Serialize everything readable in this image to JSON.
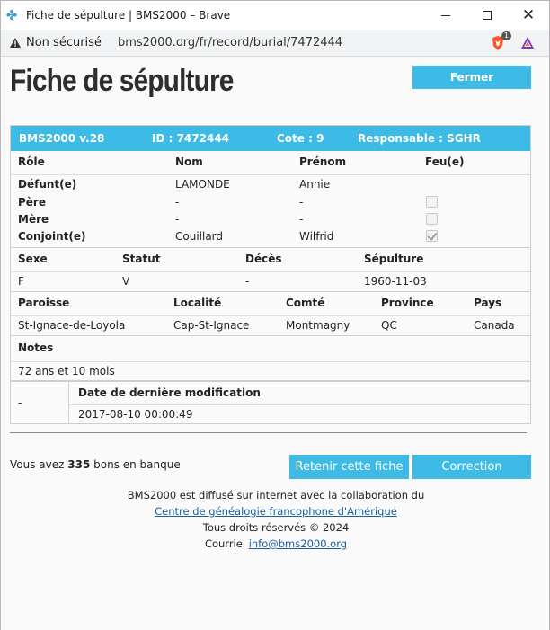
{
  "window": {
    "title": "Fiche de sépulture | BMS2000 – Brave",
    "minimize": "—",
    "maximize": "☐",
    "close": "✕"
  },
  "address_bar": {
    "security_label": "Non sécurisé",
    "url": "bms2000.org/fr/record/burial/7472444",
    "brave_badge": "1"
  },
  "page": {
    "title": "Fiche de sépulture",
    "close_button": "Fermer"
  },
  "record": {
    "header": {
      "version": "BMS2000 v.28",
      "id": "ID : 7472444",
      "cote": "Cote : 9",
      "responsable": "Responsable : SGHR"
    },
    "persons_headers": {
      "role": "Rôle",
      "nom": "Nom",
      "prenom": "Prénom",
      "feu": "Feu(e)"
    },
    "persons": [
      {
        "role": "Défunt(e)",
        "nom": "LAMONDE",
        "prenom": "Annie",
        "feu": null
      },
      {
        "role": "Père",
        "nom": "-",
        "prenom": "-",
        "feu": false
      },
      {
        "role": "Mère",
        "nom": "-",
        "prenom": "-",
        "feu": false
      },
      {
        "role": "Conjoint(e)",
        "nom": "Couillard",
        "prenom": "Wilfrid",
        "feu": true
      }
    ],
    "details_headers": {
      "sexe": "Sexe",
      "statut": "Statut",
      "deces": "Décès",
      "sepulture": "Sépulture"
    },
    "details": {
      "sexe": "F",
      "statut": "V",
      "deces": "-",
      "sepulture": "1960-11-03"
    },
    "place_headers": {
      "paroisse": "Paroisse",
      "localite": "Localité",
      "comte": "Comté",
      "province": "Province",
      "pays": "Pays"
    },
    "place": {
      "paroisse": "St-Ignace-de-Loyola",
      "localite": "Cap-St-Ignace",
      "comte": "Montmagny",
      "province": "QC",
      "pays": "Canada"
    },
    "notes_header": "Notes",
    "notes": "72 ans et 10 mois",
    "modif_left": "-",
    "modif_header": "Date de dernière modification",
    "modif_value": "2017-08-10 00:00:49"
  },
  "bank": {
    "prefix": "Vous avez ",
    "count": "335",
    "suffix": " bons en banque"
  },
  "actions": {
    "keep": "Retenir cette fiche",
    "correction": "Correction"
  },
  "footer": {
    "line1": "BMS2000 est diffusé sur internet avec la collaboration du",
    "link": "Centre de généalogie francophone d'Amérique",
    "line3": "Tous droits réservés © 2024",
    "email_prefix": "Courriel ",
    "email": "info@bms2000.org"
  },
  "colors": {
    "accent": "#3dbbe6",
    "link": "#1a5f9e"
  }
}
